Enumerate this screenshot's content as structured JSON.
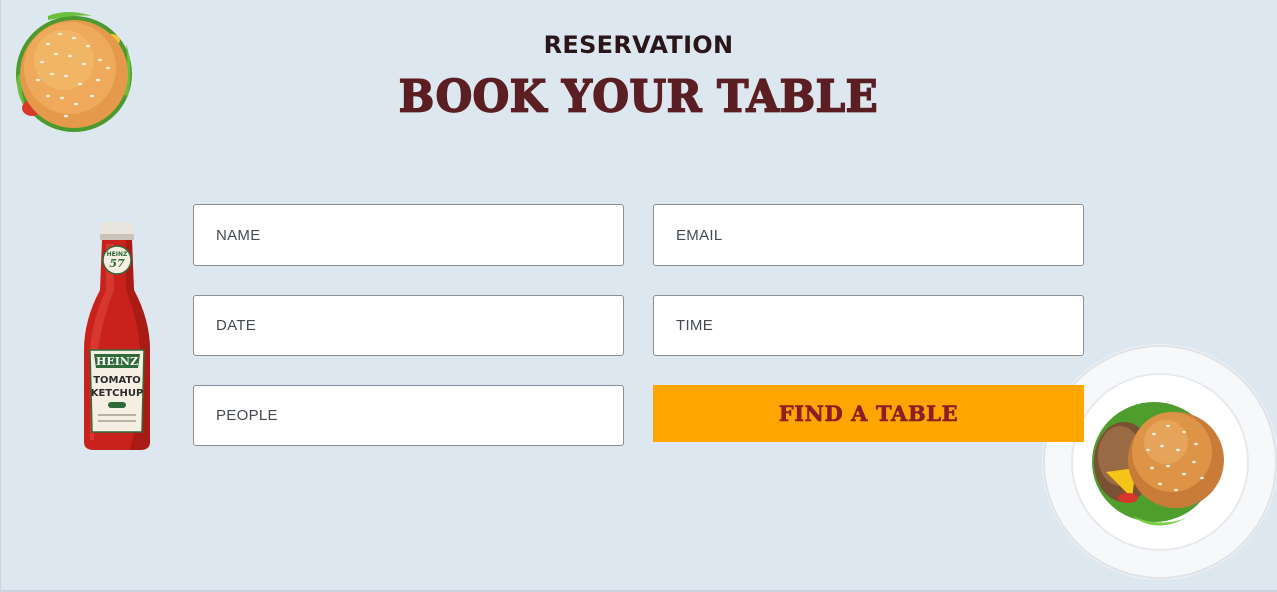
{
  "header": {
    "eyebrow": "RESERVATION",
    "title": "BOOK YOUR TABLE"
  },
  "form": {
    "name_placeholder": "NAME",
    "email_placeholder": "EMAIL",
    "date_placeholder": "DATE",
    "time_placeholder": "TIME",
    "people_placeholder": "PEOPLE",
    "submit_label": "FIND A TABLE"
  },
  "decorations": {
    "top_left_image": "burger-illustration",
    "left_image": "ketchup-bottle",
    "bottle_label_brand": "HEINZ",
    "bottle_label_line1": "TOMATO",
    "bottle_label_line2": "KETCHUP",
    "bottle_cap_number": "57",
    "bottom_right_image": "burger-on-plate"
  },
  "colors": {
    "background": "#dde7ef",
    "heading": "#2a1518",
    "title": "#5b1e22",
    "button_bg": "#fea500",
    "button_text": "#8b1e26",
    "field_border": "#8a8f96"
  }
}
